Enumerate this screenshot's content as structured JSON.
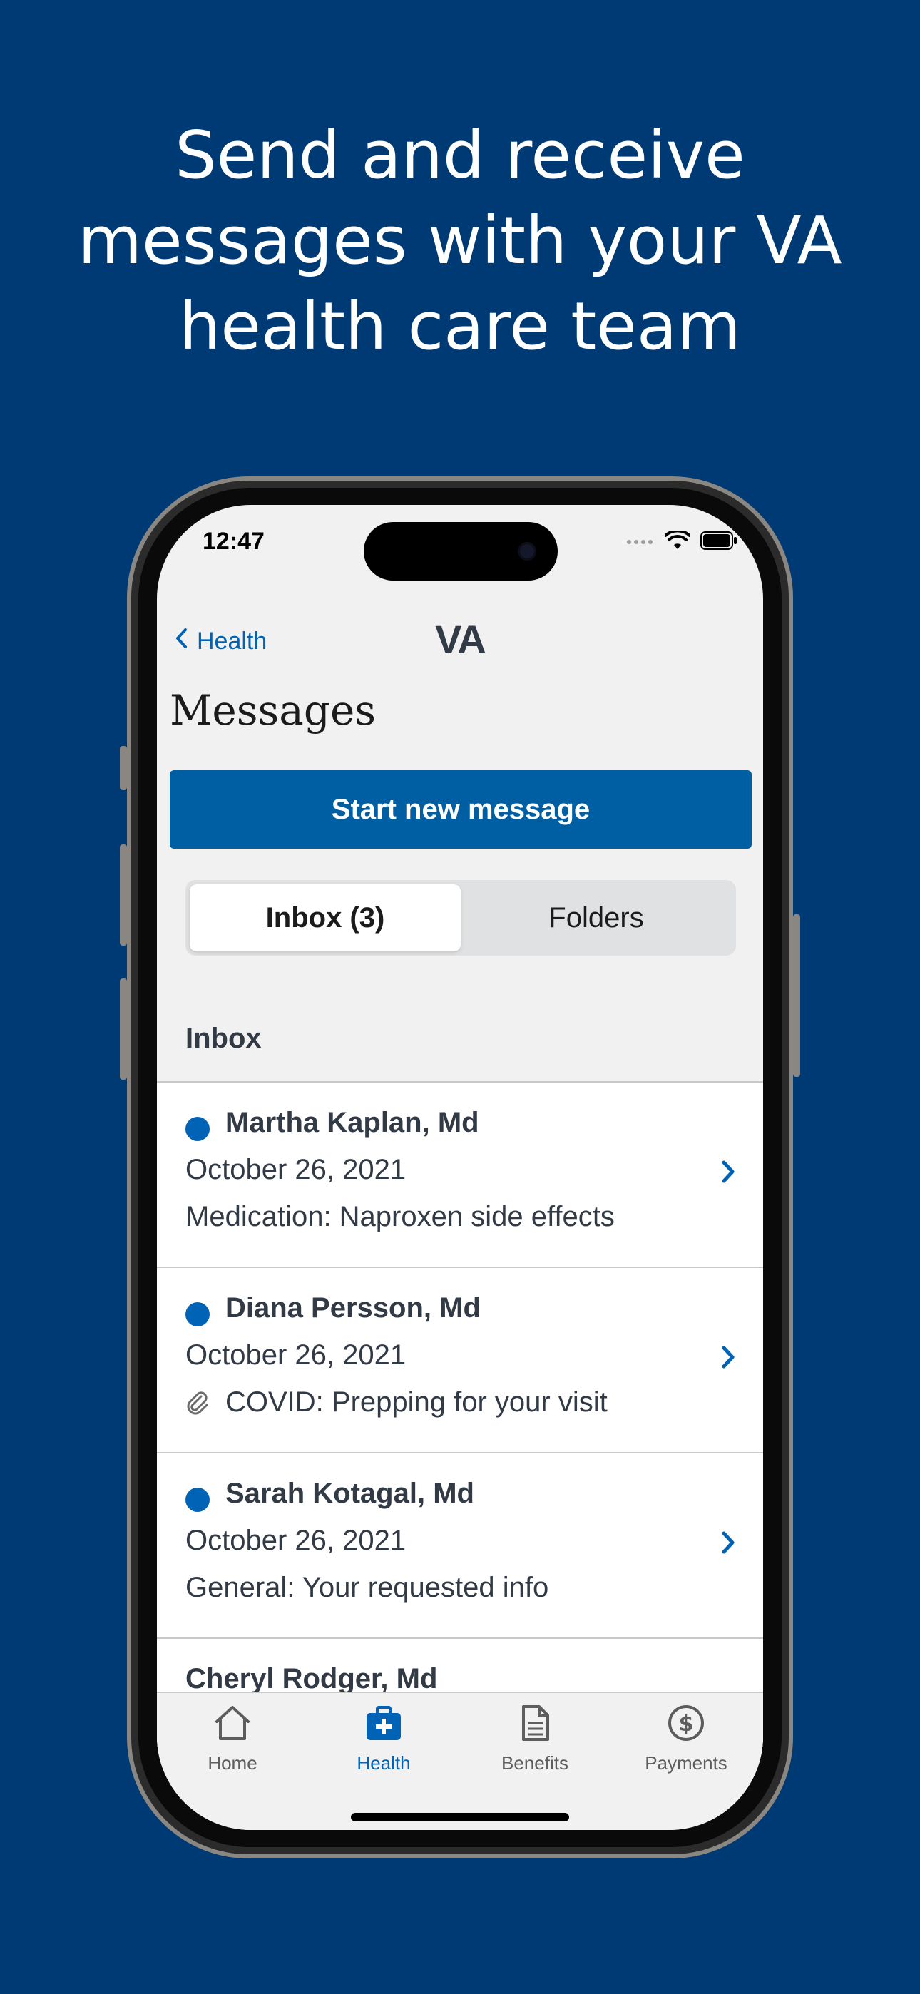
{
  "headline": {
    "line1": "Send and receive",
    "line2": "messages with your VA",
    "line3": "health care team"
  },
  "status_bar": {
    "time": "12:47"
  },
  "nav": {
    "back_label": "Health",
    "logo": "VA"
  },
  "page": {
    "title": "Messages"
  },
  "actions": {
    "start_new_message": "Start new message"
  },
  "segments": [
    {
      "label": "Inbox (3)",
      "selected": true
    },
    {
      "label": "Folders",
      "selected": false
    }
  ],
  "section_label": "Inbox",
  "messages": [
    {
      "sender": "Martha Kaplan, Md",
      "date": "October 26, 2021",
      "subject": "Medication: Naproxen side effects",
      "unread": true,
      "attachment": false
    },
    {
      "sender": "Diana Persson, Md",
      "date": "October 26, 2021",
      "subject": "COVID: Prepping for your visit",
      "unread": true,
      "attachment": true
    },
    {
      "sender": "Sarah Kotagal, Md",
      "date": "October 26, 2021",
      "subject": "General: Your requested info",
      "unread": true,
      "attachment": false
    },
    {
      "sender": "Cheryl Rodger, Md",
      "date": "",
      "subject": "",
      "unread": false,
      "attachment": false
    }
  ],
  "tabbar": [
    {
      "label": "Home",
      "icon": "home-icon",
      "active": false
    },
    {
      "label": "Health",
      "icon": "medkit-icon",
      "active": true
    },
    {
      "label": "Benefits",
      "icon": "document-icon",
      "active": false
    },
    {
      "label": "Payments",
      "icon": "dollar-circle-icon",
      "active": false
    }
  ],
  "colors": {
    "background": "#003a75",
    "primary": "#005ea2",
    "link": "#0063b6",
    "unread_dot": "#0063b6"
  }
}
